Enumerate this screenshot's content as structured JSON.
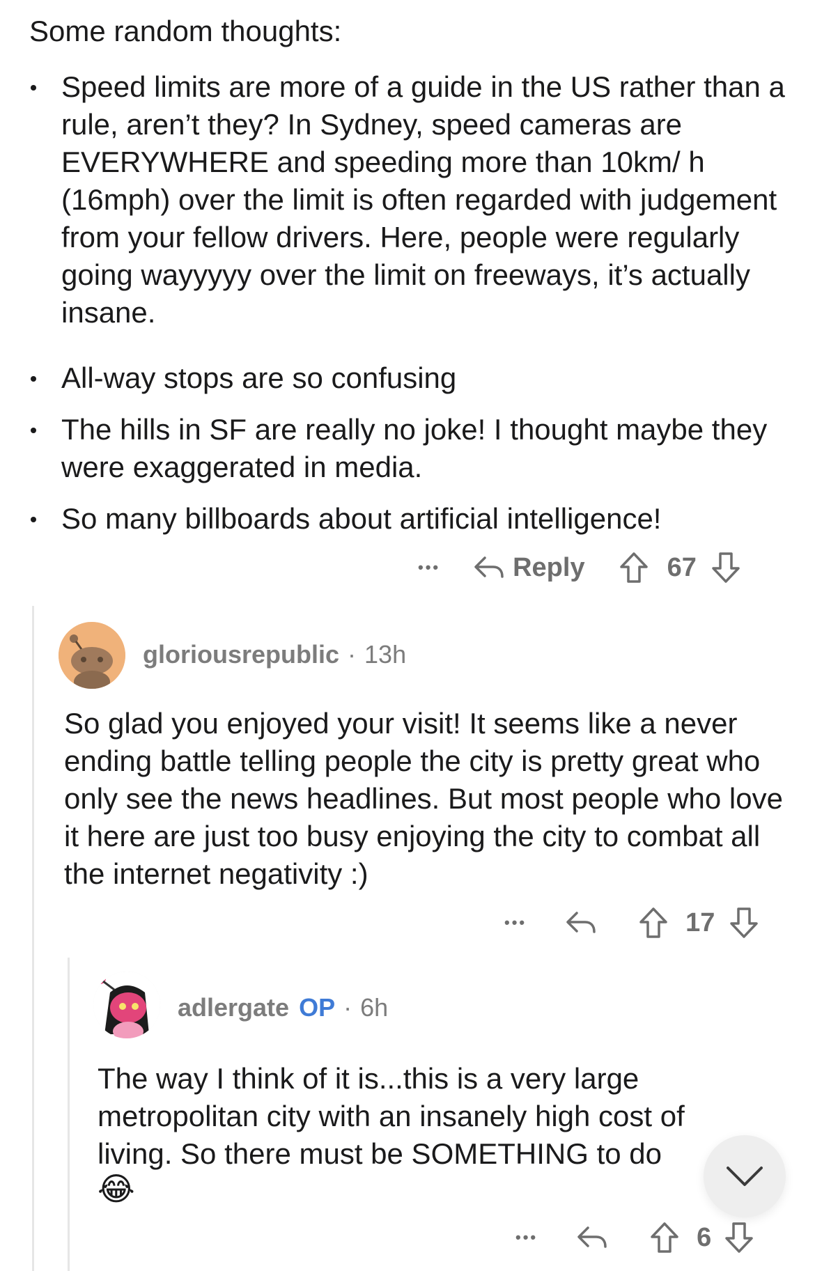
{
  "post": {
    "intro": "Some random thoughts:",
    "bullets": [
      "Speed limits are more of a guide in the US rather than a rule, aren’t they? In Sydney, speed cameras are EVERYWHERE and speeding more than 10km/ h (16mph) over the limit is often regarded with judgement from your fellow drivers. Here, people were regularly going wayyyyy over the limit on freeways, it’s actually insane.",
      "All-way stops are so confusing",
      "The hills in SF are really no joke! I thought maybe they were exaggerated in media.",
      "So many billboards about artificial intelligence!"
    ],
    "actions": {
      "more": "•••",
      "reply": "Reply",
      "score": "67"
    }
  },
  "comment1": {
    "username": "gloriousrepublic",
    "separator": "·",
    "time": "13h",
    "body": "So glad you enjoyed your visit! It seems like a never ending battle telling people the city is pretty great who only see the news headlines. But most people who love it here are just too busy enjoying the city to combat all the internet negativity :)",
    "actions": {
      "more": "•••",
      "score": "17"
    }
  },
  "comment2": {
    "username": "adlergate",
    "op_badge": "OP",
    "separator": "·",
    "time": "6h",
    "body": "The way I think of it is...this is a very large metropolitan city with an insanely high cost of living. So there must be SOMETHING to do",
    "emoji": "😂",
    "actions": {
      "more": "•••",
      "score": "6"
    }
  },
  "icons": {
    "reply": "reply-arrow-icon",
    "upvote": "upvote-arrow-icon",
    "downvote": "downvote-arrow-icon",
    "scroll": "chevron-down-icon"
  },
  "colors": {
    "op_badge": "#3f7bd6",
    "meta_text": "#7c7c7c",
    "avatar1_bg": "#f0b27a",
    "avatar2_bg": "#f3f3f3"
  }
}
